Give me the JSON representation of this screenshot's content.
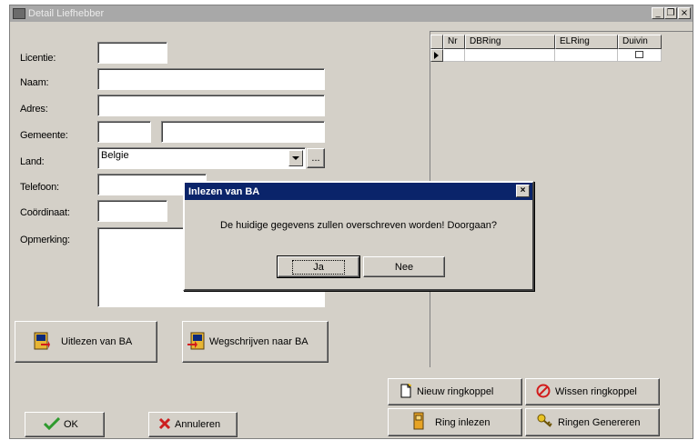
{
  "window": {
    "title": "Detail Liefhebber",
    "minimize_glyph": "_",
    "restore_glyph": "❐",
    "close_glyph": "×"
  },
  "form": {
    "licentie_label": "Licentie:",
    "naam_label": "Naam:",
    "adres_label": "Adres:",
    "gemeente_label": "Gemeente:",
    "land_label": "Land:",
    "land_value": "Belgie",
    "telefoon_label": "Telefoon:",
    "coordinaat_label": "Coördinaat:",
    "opmerking_label": "Opmerking:",
    "browse_label": "..."
  },
  "grid": {
    "columns": [
      "Nr",
      "DBRing",
      "ELRing",
      "Duivin"
    ]
  },
  "buttons": {
    "uitlezen": "Uitlezen van BA",
    "wegschrijven": "Wegschrijven naar BA",
    "nieuw": "Nieuw ringkoppel",
    "wissen": "Wissen ringkoppel",
    "ring_inlezen": "Ring inlezen",
    "ringen_genereren": "Ringen Genereren",
    "ok": "OK",
    "annuleren": "Annuleren"
  },
  "dialog": {
    "title": "Inlezen van BA",
    "message": "De huidige gegevens zullen overschreven worden! Doorgaan?",
    "yes": "Ja",
    "no": "Nee",
    "close_glyph": "×"
  },
  "colors": {
    "face": "#d4d0c8",
    "dialog_title": "#0a246a",
    "inactive_title": "#a8a8a8",
    "ok_check": "#2e9a2e",
    "cancel_x": "#cc1f1f",
    "wissen_icon": "#d21c1c"
  },
  "icons": {
    "app": "app-icon",
    "dropdown": "chevron-down-icon",
    "row_pointer": "row-pointer-icon",
    "uitlezen": "read-device-icon",
    "wegschrijven": "write-device-icon",
    "nieuw": "new-document-icon",
    "wissen": "no-entry-icon",
    "ring_inlezen": "ring-device-icon",
    "ringen_genereren": "key-icon",
    "ok": "checkmark-icon",
    "annuleren": "cancel-x-icon"
  }
}
